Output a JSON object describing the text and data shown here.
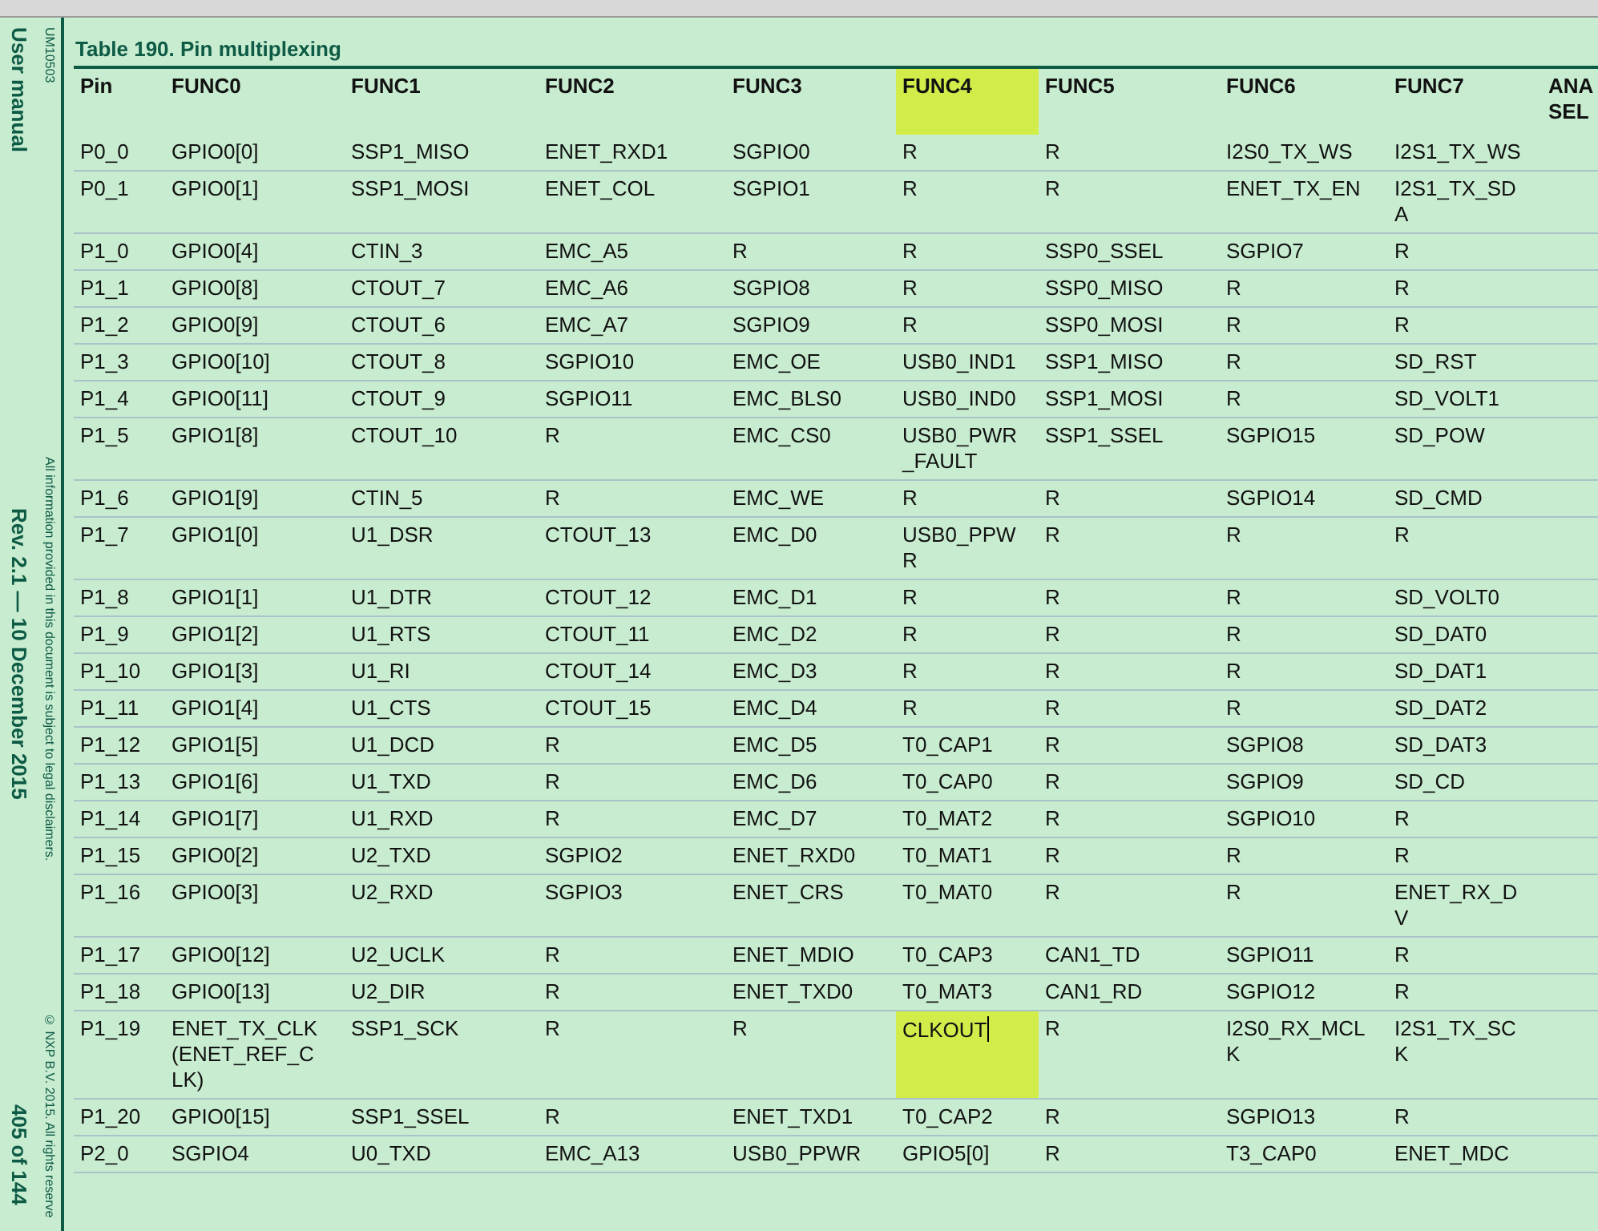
{
  "margin": {
    "doc_type": "User manual",
    "revision": "Rev. 2.1 — 10 December 2015",
    "page": "405 of 144",
    "doc_id": "UM10503",
    "disclaimer": "All information provided in this document is subject to legal disclaimers.",
    "copyright": "© NXP B.V. 2015. All rights reserve"
  },
  "table": {
    "title": "Table 190.  Pin multiplexing",
    "columns": [
      {
        "label": "Pin",
        "highlighted": false
      },
      {
        "label": "FUNC0",
        "highlighted": false
      },
      {
        "label": "FUNC1",
        "highlighted": false
      },
      {
        "label": "FUNC2",
        "highlighted": false
      },
      {
        "label": "FUNC3",
        "highlighted": false
      },
      {
        "label": "FUNC4",
        "highlighted": true
      },
      {
        "label": "FUNC5",
        "highlighted": false
      },
      {
        "label": "FUNC6",
        "highlighted": false
      },
      {
        "label": "FUNC7",
        "highlighted": false
      },
      {
        "label": "ANA SEL",
        "highlighted": false
      }
    ],
    "rows": [
      [
        "P0_0",
        "GPIO0[0]",
        "SSP1_MISO",
        "ENET_RXD1",
        "SGPIO0",
        "R",
        "R",
        "I2S0_TX_WS",
        "I2S1_TX_WS"
      ],
      [
        "P0_1",
        "GPIO0[1]",
        "SSP1_MOSI",
        "ENET_COL",
        "SGPIO1",
        "R",
        "R",
        "ENET_TX_EN",
        "I2S1_TX_SDA"
      ],
      [
        "P1_0",
        "GPIO0[4]",
        "CTIN_3",
        "EMC_A5",
        "R",
        "R",
        "SSP0_SSEL",
        "SGPIO7",
        "R"
      ],
      [
        "P1_1",
        "GPIO0[8]",
        "CTOUT_7",
        "EMC_A6",
        "SGPIO8",
        "R",
        "SSP0_MISO",
        "R",
        "R"
      ],
      [
        "P1_2",
        "GPIO0[9]",
        "CTOUT_6",
        "EMC_A7",
        "SGPIO9",
        "R",
        "SSP0_MOSI",
        "R",
        "R"
      ],
      [
        "P1_3",
        "GPIO0[10]",
        "CTOUT_8",
        "SGPIO10",
        "EMC_OE",
        "USB0_IND1",
        "SSP1_MISO",
        "R",
        "SD_RST"
      ],
      [
        "P1_4",
        "GPIO0[11]",
        "CTOUT_9",
        "SGPIO11",
        "EMC_BLS0",
        "USB0_IND0",
        "SSP1_MOSI",
        "R",
        "SD_VOLT1"
      ],
      [
        "P1_5",
        "GPIO1[8]",
        "CTOUT_10",
        "R",
        "EMC_CS0",
        "USB0_PWR_FAULT",
        "SSP1_SSEL",
        "SGPIO15",
        "SD_POW"
      ],
      [
        "P1_6",
        "GPIO1[9]",
        "CTIN_5",
        "R",
        "EMC_WE",
        "R",
        "R",
        "SGPIO14",
        "SD_CMD"
      ],
      [
        "P1_7",
        "GPIO1[0]",
        "U1_DSR",
        "CTOUT_13",
        "EMC_D0",
        "USB0_PPWR",
        "R",
        "R",
        "R"
      ],
      [
        "P1_8",
        "GPIO1[1]",
        "U1_DTR",
        "CTOUT_12",
        "EMC_D1",
        "R",
        "R",
        "R",
        "SD_VOLT0"
      ],
      [
        "P1_9",
        "GPIO1[2]",
        "U1_RTS",
        "CTOUT_11",
        "EMC_D2",
        "R",
        "R",
        "R",
        "SD_DAT0"
      ],
      [
        "P1_10",
        "GPIO1[3]",
        "U1_RI",
        "CTOUT_14",
        "EMC_D3",
        "R",
        "R",
        "R",
        "SD_DAT1"
      ],
      [
        "P1_11",
        "GPIO1[4]",
        "U1_CTS",
        "CTOUT_15",
        "EMC_D4",
        "R",
        "R",
        "R",
        "SD_DAT2"
      ],
      [
        "P1_12",
        "GPIO1[5]",
        "U1_DCD",
        "R",
        "EMC_D5",
        "T0_CAP1",
        "R",
        "SGPIO8",
        "SD_DAT3"
      ],
      [
        "P1_13",
        "GPIO1[6]",
        "U1_TXD",
        "R",
        "EMC_D6",
        "T0_CAP0",
        "R",
        "SGPIO9",
        "SD_CD"
      ],
      [
        "P1_14",
        "GPIO1[7]",
        "U1_RXD",
        "R",
        "EMC_D7",
        "T0_MAT2",
        "R",
        "SGPIO10",
        "R"
      ],
      [
        "P1_15",
        "GPIO0[2]",
        "U2_TXD",
        "SGPIO2",
        "ENET_RXD0",
        "T0_MAT1",
        "R",
        "R",
        "R"
      ],
      [
        "P1_16",
        "GPIO0[3]",
        "U2_RXD",
        "SGPIO3",
        "ENET_CRS",
        "T0_MAT0",
        "R",
        "R",
        "ENET_RX_DV"
      ],
      [
        "P1_17",
        "GPIO0[12]",
        "U2_UCLK",
        "R",
        "ENET_MDIO",
        "T0_CAP3",
        "CAN1_TD",
        "SGPIO11",
        "R"
      ],
      [
        "P1_18",
        "GPIO0[13]",
        "U2_DIR",
        "R",
        "ENET_TXD0",
        "T0_MAT3",
        "CAN1_RD",
        "SGPIO12",
        "R"
      ],
      [
        "P1_19",
        "ENET_TX_CLK (ENET_REF_CLK)",
        "SSP1_SCK",
        "R",
        "R",
        {
          "text": "CLKOUT",
          "highlighted": true,
          "cursor": true
        },
        "R",
        "I2S0_RX_MCLK",
        "I2S1_TX_SCK"
      ],
      [
        "P1_20",
        "GPIO0[15]",
        "SSP1_SSEL",
        "R",
        "ENET_TXD1",
        "T0_CAP2",
        "R",
        "SGPIO13",
        "R"
      ],
      [
        "P2_0",
        "SGPIO4",
        "U0_TXD",
        "EMC_A13",
        "USB0_PPWR",
        "GPIO5[0]",
        "R",
        "T3_CAP0",
        "ENET_MDC"
      ]
    ]
  }
}
